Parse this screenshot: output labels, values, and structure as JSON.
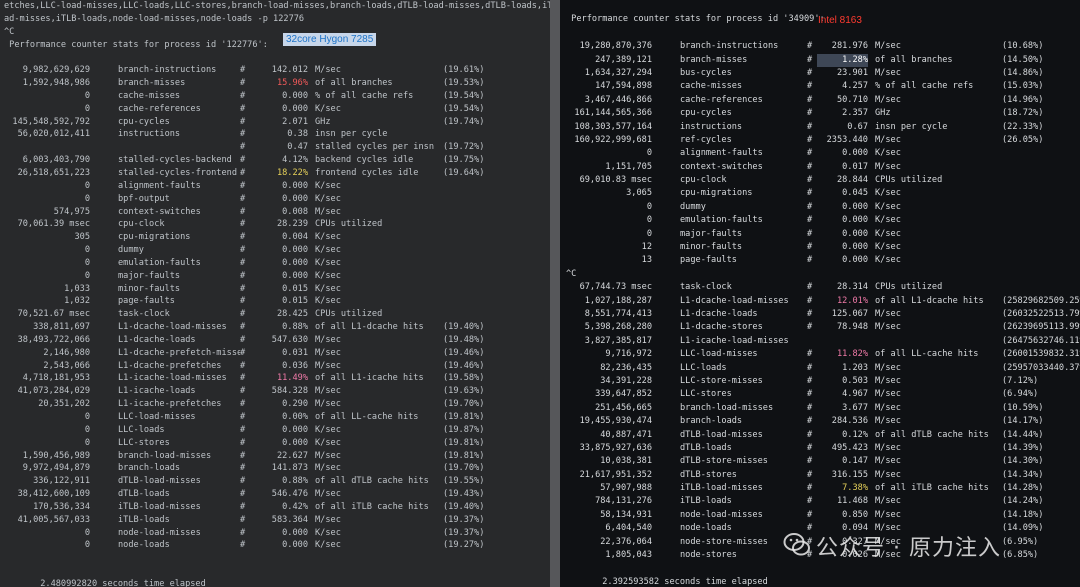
{
  "left": {
    "header": [
      "etches,LLC-load-misses,LLC-loads,LLC-stores,branch-load-misses,branch-loads,dTLB-load-misses,dTLB-loads,iTLB-lo",
      "ad-misses,iTLB-loads,node-load-misses,node-loads -p 122776",
      "^C",
      " Performance counter stats for process id '122776':"
    ],
    "cpu_tag": "32core Hygon 7285",
    "rows": [
      {
        "n": "9,982,629,629",
        "e": "branch-instructions",
        "h": "#",
        "v": "142.012",
        "d": "M/sec",
        "p": "(19.61%)"
      },
      {
        "n": "1,592,948,986",
        "e": "branch-misses",
        "h": "#",
        "v": "15.96%",
        "d": "of all branches",
        "p": "(19.53%)",
        "c": "hl-red"
      },
      {
        "n": "0",
        "e": "cache-misses",
        "h": "#",
        "v": "0.000",
        "d": "% of all cache refs",
        "p": "(19.54%)"
      },
      {
        "n": "0",
        "e": "cache-references",
        "h": "#",
        "v": "0.000",
        "d": "K/sec",
        "p": "(19.54%)"
      },
      {
        "n": "145,548,592,792",
        "e": "cpu-cycles",
        "h": "#",
        "v": "2.071",
        "d": "GHz",
        "p": "(19.74%)"
      },
      {
        "n": "56,020,012,411",
        "e": "instructions",
        "h": "#",
        "v": "0.38",
        "d": "insn per cycle",
        "p": ""
      },
      {
        "n": "",
        "e": "",
        "h": "#",
        "v": "0.47",
        "d": "stalled cycles per insn",
        "p": "(19.72%)"
      },
      {
        "n": "6,003,403,790",
        "e": "stalled-cycles-backend",
        "h": "#",
        "v": "4.12%",
        "d": "backend cycles idle",
        "p": "(19.75%)"
      },
      {
        "n": "26,518,651,223",
        "e": "stalled-cycles-frontend",
        "h": "#",
        "v": "18.22%",
        "d": "frontend cycles idle",
        "p": "(19.64%)",
        "c": "hl-yel"
      },
      {
        "n": "0",
        "e": "alignment-faults",
        "h": "#",
        "v": "0.000",
        "d": "K/sec",
        "p": ""
      },
      {
        "n": "0",
        "e": "bpf-output",
        "h": "#",
        "v": "0.000",
        "d": "K/sec",
        "p": ""
      },
      {
        "n": "574,975",
        "e": "context-switches",
        "h": "#",
        "v": "0.008",
        "d": "M/sec",
        "p": ""
      },
      {
        "n": "70,061.39 msec",
        "e": "cpu-clock",
        "h": "#",
        "v": "28.239",
        "d": "CPUs utilized",
        "p": ""
      },
      {
        "n": "305",
        "e": "cpu-migrations",
        "h": "#",
        "v": "0.004",
        "d": "K/sec",
        "p": ""
      },
      {
        "n": "0",
        "e": "dummy",
        "h": "#",
        "v": "0.000",
        "d": "K/sec",
        "p": ""
      },
      {
        "n": "0",
        "e": "emulation-faults",
        "h": "#",
        "v": "0.000",
        "d": "K/sec",
        "p": ""
      },
      {
        "n": "0",
        "e": "major-faults",
        "h": "#",
        "v": "0.000",
        "d": "K/sec",
        "p": ""
      },
      {
        "n": "1,033",
        "e": "minor-faults",
        "h": "#",
        "v": "0.015",
        "d": "K/sec",
        "p": ""
      },
      {
        "n": "1,032",
        "e": "page-faults",
        "h": "#",
        "v": "0.015",
        "d": "K/sec",
        "p": ""
      },
      {
        "n": "70,521.67 msec",
        "e": "task-clock",
        "h": "#",
        "v": "28.425",
        "d": "CPUs utilized",
        "p": ""
      },
      {
        "n": "338,811,697",
        "e": "L1-dcache-load-misses",
        "h": "#",
        "v": "0.88%",
        "d": "of all L1-dcache hits",
        "p": "(19.40%)"
      },
      {
        "n": "38,493,722,066",
        "e": "L1-dcache-loads",
        "h": "#",
        "v": "547.630",
        "d": "M/sec",
        "p": "(19.48%)"
      },
      {
        "n": "2,146,980",
        "e": "L1-dcache-prefetch-misses",
        "h": "#",
        "v": "0.031",
        "d": "M/sec",
        "p": "(19.46%)"
      },
      {
        "n": "2,543,066",
        "e": "L1-dcache-prefetches",
        "h": "#",
        "v": "0.036",
        "d": "M/sec",
        "p": "(19.46%)"
      },
      {
        "n": "4,718,181,953",
        "e": "L1-icache-load-misses",
        "h": "#",
        "v": "11.49%",
        "d": "of all L1-icache hits",
        "p": "(19.58%)",
        "c": "hl-pink"
      },
      {
        "n": "41,073,284,029",
        "e": "L1-icache-loads",
        "h": "#",
        "v": "584.328",
        "d": "M/sec",
        "p": "(19.63%)"
      },
      {
        "n": "20,351,202",
        "e": "L1-icache-prefetches",
        "h": "#",
        "v": "0.290",
        "d": "M/sec",
        "p": "(19.70%)"
      },
      {
        "n": "0",
        "e": "LLC-load-misses",
        "h": "#",
        "v": "0.00%",
        "d": "of all LL-cache hits",
        "p": "(19.81%)"
      },
      {
        "n": "0",
        "e": "LLC-loads",
        "h": "#",
        "v": "0.000",
        "d": "K/sec",
        "p": "(19.87%)"
      },
      {
        "n": "0",
        "e": "LLC-stores",
        "h": "#",
        "v": "0.000",
        "d": "K/sec",
        "p": "(19.81%)"
      },
      {
        "n": "1,590,456,989",
        "e": "branch-load-misses",
        "h": "#",
        "v": "22.627",
        "d": "M/sec",
        "p": "(19.81%)"
      },
      {
        "n": "9,972,494,879",
        "e": "branch-loads",
        "h": "#",
        "v": "141.873",
        "d": "M/sec",
        "p": "(19.70%)"
      },
      {
        "n": "336,122,911",
        "e": "dTLB-load-misses",
        "h": "#",
        "v": "0.88%",
        "d": "of all dTLB cache hits",
        "p": "(19.55%)"
      },
      {
        "n": "38,412,600,109",
        "e": "dTLB-loads",
        "h": "#",
        "v": "546.476",
        "d": "M/sec",
        "p": "(19.43%)"
      },
      {
        "n": "170,536,334",
        "e": "iTLB-load-misses",
        "h": "#",
        "v": "0.42%",
        "d": "of all iTLB cache hits",
        "p": "(19.40%)"
      },
      {
        "n": "41,005,567,033",
        "e": "iTLB-loads",
        "h": "#",
        "v": "583.364",
        "d": "M/sec",
        "p": "(19.37%)"
      },
      {
        "n": "0",
        "e": "node-load-misses",
        "h": "#",
        "v": "0.000",
        "d": "K/sec",
        "p": "(19.37%)"
      },
      {
        "n": "0",
        "e": "node-loads",
        "h": "#",
        "v": "0.000",
        "d": "K/sec",
        "p": "(19.27%)"
      }
    ],
    "elapsed": "       2.480992820 seconds time elapsed"
  },
  "right": {
    "header": [
      " Performance counter stats for process id '34909':"
    ],
    "cpu_tag": "Intel 8163",
    "rows": [
      {
        "n": "19,280,870,376",
        "e": "branch-instructions",
        "h": "#",
        "v": "281.976",
        "d": "M/sec",
        "p": "(10.68%)"
      },
      {
        "n": "247,389,121",
        "e": "branch-misses",
        "h": "#",
        "v": "1.28%",
        "d": "of all branches",
        "p": "(14.50%)",
        "c": "hl-sel"
      },
      {
        "n": "1,634,327,294",
        "e": "bus-cycles",
        "h": "#",
        "v": "23.901",
        "d": "M/sec",
        "p": "(14.86%)"
      },
      {
        "n": "147,594,898",
        "e": "cache-misses",
        "h": "#",
        "v": "4.257",
        "d": "% of all cache refs",
        "p": "(15.03%)"
      },
      {
        "n": "3,467,446,866",
        "e": "cache-references",
        "h": "#",
        "v": "50.710",
        "d": "M/sec",
        "p": "(14.96%)"
      },
      {
        "n": "161,144,565,366",
        "e": "cpu-cycles",
        "h": "#",
        "v": "2.357",
        "d": "GHz",
        "p": "(18.72%)"
      },
      {
        "n": "108,303,577,164",
        "e": "instructions",
        "h": "#",
        "v": "0.67",
        "d": "insn per cycle",
        "p": "(22.33%)"
      },
      {
        "n": "160,922,999,681",
        "e": "ref-cycles",
        "h": "#",
        "v": "2353.440",
        "d": "M/sec",
        "p": "(26.05%)"
      },
      {
        "n": "0",
        "e": "alignment-faults",
        "h": "#",
        "v": "0.000",
        "d": "K/sec",
        "p": ""
      },
      {
        "n": "1,151,705",
        "e": "context-switches",
        "h": "#",
        "v": "0.017",
        "d": "M/sec",
        "p": ""
      },
      {
        "n": "69,010.83 msec",
        "e": "cpu-clock",
        "h": "#",
        "v": "28.844",
        "d": "CPUs utilized",
        "p": ""
      },
      {
        "n": "3,065",
        "e": "cpu-migrations",
        "h": "#",
        "v": "0.045",
        "d": "K/sec",
        "p": ""
      },
      {
        "n": "0",
        "e": "dummy",
        "h": "#",
        "v": "0.000",
        "d": "K/sec",
        "p": ""
      },
      {
        "n": "0",
        "e": "emulation-faults",
        "h": "#",
        "v": "0.000",
        "d": "K/sec",
        "p": ""
      },
      {
        "n": "0",
        "e": "major-faults",
        "h": "#",
        "v": "0.000",
        "d": "K/sec",
        "p": ""
      },
      {
        "n": "12",
        "e": "minor-faults",
        "h": "#",
        "v": "0.000",
        "d": "K/sec",
        "p": ""
      },
      {
        "n": "13",
        "e": "page-faults",
        "h": "#",
        "v": "0.000",
        "d": "K/sec",
        "p": ""
      }
    ],
    "ctrl_c": "^C",
    "rows2": [
      {
        "n": "67,744.73 msec",
        "e": "task-clock",
        "h": "#",
        "v": "28.314",
        "d": "CPUs utilized",
        "p": ""
      },
      {
        "n": "1,027,188,287",
        "e": "L1-dcache-load-misses",
        "h": "#",
        "v": "12.01%",
        "d": "of all L1-dcache hits",
        "p": "(25829682509.25%)",
        "c": "hl-pink"
      },
      {
        "n": "8,551,774,413",
        "e": "L1-dcache-loads",
        "h": "#",
        "v": "125.067",
        "d": "M/sec",
        "p": "(26032522513.79%)"
      },
      {
        "n": "5,398,268,280",
        "e": "L1-dcache-stores",
        "h": "#",
        "v": "78.948",
        "d": "M/sec",
        "p": "(26239695113.99%)"
      },
      {
        "n": "3,827,385,817",
        "e": "L1-icache-load-misses",
        "h": "",
        "v": "",
        "d": "",
        "p": "(26475632746.11%)"
      },
      {
        "n": "9,716,972",
        "e": "LLC-load-misses",
        "h": "#",
        "v": "11.82%",
        "d": "of all LL-cache hits",
        "p": "(26001539832.31%)",
        "c": "hl-pink"
      },
      {
        "n": "82,236,435",
        "e": "LLC-loads",
        "h": "#",
        "v": "1.203",
        "d": "M/sec",
        "p": "(25957033440.37%)"
      },
      {
        "n": "34,391,228",
        "e": "LLC-store-misses",
        "h": "#",
        "v": "0.503",
        "d": "M/sec",
        "p": "(7.12%)"
      },
      {
        "n": "339,647,852",
        "e": "LLC-stores",
        "h": "#",
        "v": "4.967",
        "d": "M/sec",
        "p": "(6.94%)"
      },
      {
        "n": "251,456,665",
        "e": "branch-load-misses",
        "h": "#",
        "v": "3.677",
        "d": "M/sec",
        "p": "(10.59%)"
      },
      {
        "n": "19,455,930,474",
        "e": "branch-loads",
        "h": "#",
        "v": "284.536",
        "d": "M/sec",
        "p": "(14.17%)"
      },
      {
        "n": "40,887,471",
        "e": "dTLB-load-misses",
        "h": "#",
        "v": "0.12%",
        "d": "of all dTLB cache hits",
        "p": "(14.44%)"
      },
      {
        "n": "33,875,927,636",
        "e": "dTLB-loads",
        "h": "#",
        "v": "495.423",
        "d": "M/sec",
        "p": "(14.39%)"
      },
      {
        "n": "10,038,381",
        "e": "dTLB-store-misses",
        "h": "#",
        "v": "0.147",
        "d": "M/sec",
        "p": "(14.30%)"
      },
      {
        "n": "21,617,951,352",
        "e": "dTLB-stores",
        "h": "#",
        "v": "316.155",
        "d": "M/sec",
        "p": "(14.34%)"
      },
      {
        "n": "57,907,988",
        "e": "iTLB-load-misses",
        "h": "#",
        "v": "7.38%",
        "d": "of all iTLB cache hits",
        "p": "(14.28%)",
        "c": "hl-yel"
      },
      {
        "n": "784,131,276",
        "e": "iTLB-loads",
        "h": "#",
        "v": "11.468",
        "d": "M/sec",
        "p": "(14.24%)"
      },
      {
        "n": "58,134,931",
        "e": "node-load-misses",
        "h": "#",
        "v": "0.850",
        "d": "M/sec",
        "p": "(14.18%)"
      },
      {
        "n": "6,404,540",
        "e": "node-loads",
        "h": "#",
        "v": "0.094",
        "d": "M/sec",
        "p": "(14.09%)"
      },
      {
        "n": "22,376,064",
        "e": "node-store-misses",
        "h": "#",
        "v": "0.327",
        "d": "M/sec",
        "p": "(6.95%)"
      },
      {
        "n": "1,805,043",
        "e": "node-stores",
        "h": "#",
        "v": "0.026",
        "d": "M/sec",
        "p": "(6.85%)"
      }
    ],
    "elapsed": "       2.392593582 seconds time elapsed"
  },
  "watermark": "公众号 · 原力注入",
  "colors": {
    "left_bg": "#28292b",
    "right_bg": "#0f1114",
    "red": "#f25a5a",
    "yellow": "#e6d15a",
    "pink": "#f07aa8",
    "intel_tag": "#ff3b30",
    "hygon_tag": "#1e74c8"
  }
}
